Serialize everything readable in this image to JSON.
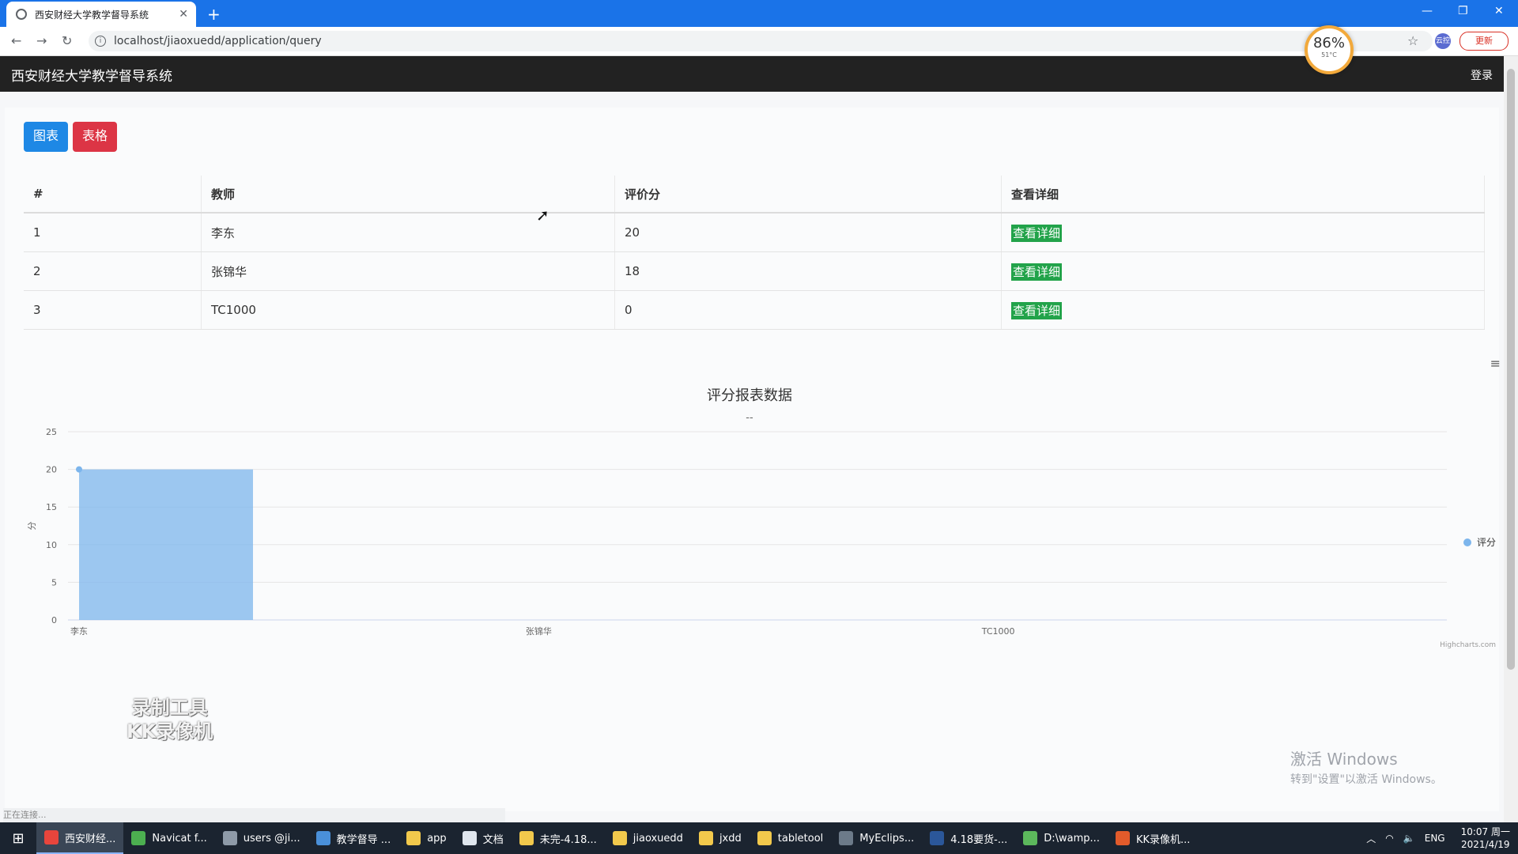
{
  "browser": {
    "tab_title": "西安财经大学教学督导系统",
    "url": "localhost/jiaoxuedd/application/query",
    "update_label": "更新",
    "profile_label": "云控"
  },
  "perf_badge": {
    "percent": "86%",
    "temp": "51°C"
  },
  "app": {
    "brand": "西安财经大学教学督导系统",
    "login": "登录"
  },
  "actions": {
    "chart_label": "图表",
    "table_label": "表格"
  },
  "table": {
    "headers": [
      "#",
      "教师",
      "评价分",
      "查看详细"
    ],
    "rows": [
      {
        "idx": "1",
        "teacher": "李东",
        "score": "20",
        "action": "查看详细"
      },
      {
        "idx": "2",
        "teacher": "张锦华",
        "score": "18",
        "action": "查看详细"
      },
      {
        "idx": "3",
        "teacher": "TC1000",
        "score": "0",
        "action": "查看详细"
      }
    ]
  },
  "chart_data": {
    "type": "area",
    "title": "评分报表数据",
    "subtitle": "--",
    "categories": [
      "李东",
      "张锦华",
      "TC1000"
    ],
    "series": [
      {
        "name": "评分",
        "values": [
          20,
          null,
          null
        ]
      }
    ],
    "ylabel": "分",
    "ylim": [
      0,
      25
    ],
    "yticks": [
      0,
      5,
      10,
      15,
      20,
      25
    ],
    "credits": "Highcharts.com",
    "legend": "right",
    "color": "#7cb5ec"
  },
  "watermarks": {
    "recorder_line1": "录制工具",
    "recorder_line2": "KK录像机",
    "windows_line1": "激活 Windows",
    "windows_line2": "转到\"设置\"以激活 Windows。"
  },
  "status": "正在连接...",
  "taskbar": {
    "items": [
      {
        "label": "西安财经...",
        "color": "#e8453c"
      },
      {
        "label": "Navicat f...",
        "color": "#4caf50"
      },
      {
        "label": "users @ji...",
        "color": "#8e9aa8"
      },
      {
        "label": "教学督导 ...",
        "color": "#4a90d9"
      },
      {
        "label": "app",
        "color": "#f2c94c"
      },
      {
        "label": "文档",
        "color": "#dfe6ee"
      },
      {
        "label": "未完-4.18...",
        "color": "#f2c94c"
      },
      {
        "label": "jiaoxuedd",
        "color": "#f2c94c"
      },
      {
        "label": "jxdd",
        "color": "#f2c94c"
      },
      {
        "label": "tabletool",
        "color": "#f2c94c"
      },
      {
        "label": "MyEclips...",
        "color": "#6c7a89"
      },
      {
        "label": "4.18要货-...",
        "color": "#2b579a"
      },
      {
        "label": "D:\\wamp...",
        "color": "#5cb85c"
      },
      {
        "label": "KK录像机...",
        "color": "#e25b2b"
      }
    ],
    "lang": "ENG",
    "time": "10:07 周一",
    "date": "2021/4/19"
  }
}
